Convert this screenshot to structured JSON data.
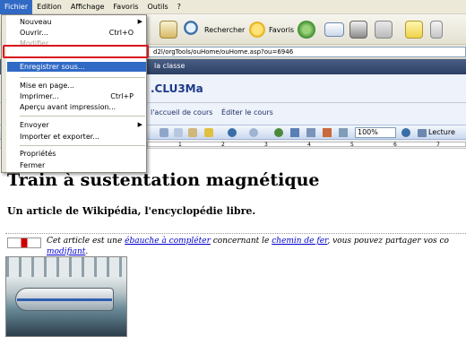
{
  "menubar": {
    "items": [
      "Fichier",
      "Edition",
      "Affichage",
      "Favoris",
      "Outils",
      "?"
    ]
  },
  "toolbar": {
    "search_label": "Rechercher",
    "favorites_label": "Favoris"
  },
  "addressbar": {
    "url_fragment": "d2l/orgTools/ouHome/ouHome.asp?ou=6946"
  },
  "site": {
    "banner_text": "la classe",
    "course_title": ".CLU3Ma",
    "links": [
      "l'accueil de cours",
      "Éditer le cours"
    ]
  },
  "wordbar": {
    "zoom": "100%",
    "reading_label": "Lecture"
  },
  "ruler": {
    "numbers": [
      "1",
      "2",
      "3",
      "4",
      "5",
      "6",
      "7"
    ]
  },
  "document": {
    "title": "Train à sustentation magnétique",
    "subtitle_prefix": "Un article de ",
    "subtitle_link": "Wikipédia",
    "subtitle_suffix": ", l'encyclopédie libre.",
    "notice_1": "Cet article est une ",
    "notice_link_1": "ébauche à compléter",
    "notice_2": " concernant le ",
    "notice_link_2": "chemin de fer",
    "notice_3": ", vous pouvez partager vos co",
    "notice_link_3": "modifiant",
    "notice_end": "."
  },
  "fichier_menu": {
    "items": [
      {
        "label": "Nouveau",
        "shortcut": "",
        "submenu": true
      },
      {
        "label": "Ouvrir...",
        "shortcut": "Ctrl+O"
      },
      {
        "label": "Modifier",
        "disabled": true
      },
      {
        "label": "Enregistrer sous...",
        "highlighted": true
      },
      {
        "label": "Mise en page..."
      },
      {
        "label": "Imprimer...",
        "shortcut": "Ctrl+P"
      },
      {
        "label": "Aperçu avant impression..."
      },
      {
        "label": "Envoyer",
        "submenu": true
      },
      {
        "label": "Importer et exporter..."
      },
      {
        "label": "Propriétés"
      },
      {
        "label": "Fermer"
      }
    ]
  },
  "colors": {
    "menu_highlight": "#316ac5",
    "callout_red": "#d8161e",
    "course_title": "#1d3a8a"
  }
}
